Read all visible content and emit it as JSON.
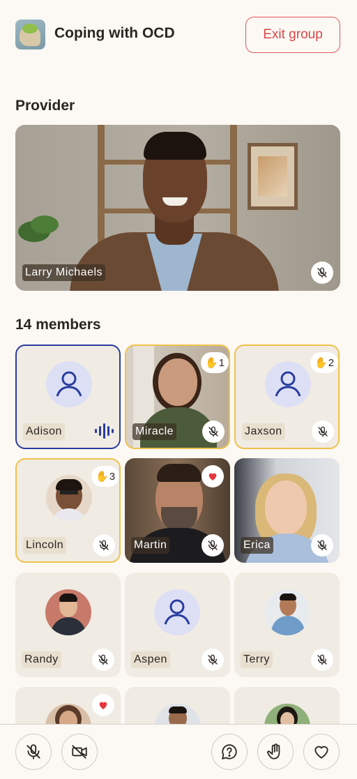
{
  "header": {
    "title": "Coping with OCD",
    "exit_label": "Exit group"
  },
  "provider": {
    "section_title": "Provider",
    "name": "Larry Michaels",
    "muted": true
  },
  "members": {
    "section_title": "14 members",
    "tiles": [
      {
        "name": "Adison",
        "avatar": "generic",
        "state": "speaking"
      },
      {
        "name": "Miracle",
        "avatar": "video",
        "hand": "1",
        "muted": true
      },
      {
        "name": "Jaxson",
        "avatar": "generic",
        "hand": "2",
        "muted": true
      },
      {
        "name": "Lincoln",
        "avatar": "photo",
        "hand": "3",
        "muted": true
      },
      {
        "name": "Martin",
        "avatar": "video",
        "reaction": "heart",
        "muted": true
      },
      {
        "name": "Erica",
        "avatar": "video",
        "muted": true
      },
      {
        "name": "Randy",
        "avatar": "photo",
        "muted": true
      },
      {
        "name": "Aspen",
        "avatar": "generic",
        "muted": true
      },
      {
        "name": "Terry",
        "avatar": "photo",
        "muted": true
      }
    ]
  },
  "colors": {
    "accent_blue": "#2a3c9e",
    "hand_yellow": "#f0c14b",
    "exit_red": "#d9464a",
    "heart_red": "#e5383b"
  },
  "toolbar": {
    "icons": [
      "mic-off-icon",
      "video-off-icon",
      "help-icon",
      "raise-hand-icon",
      "heart-icon"
    ]
  }
}
